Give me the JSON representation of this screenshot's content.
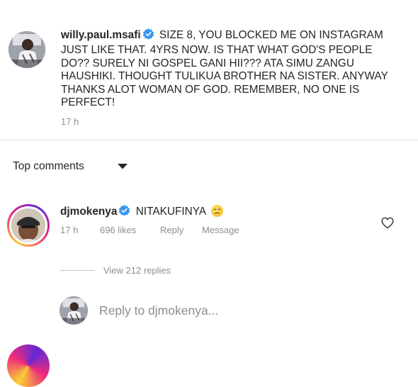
{
  "post": {
    "username": "willy.paul.msafi",
    "verified": true,
    "text": "SIZE 8, YOU BLOCKED ME ON INSTAGRAM JUST LIKE THAT. 4YRS NOW. IS THAT WHAT GOD'S PEOPLE DO?? SURELY NI GOSPEL GANI HII??? ATA SIMU ZANGU HAUSHIKI. THOUGHT TULIKUA BROTHER NA SISTER. ANYWAY THANKS ALOT WOMAN OF GOD. REMEMBER,  NO ONE IS PERFECT!",
    "time": "17 h"
  },
  "comments_header": {
    "label": "Top comments"
  },
  "comment": {
    "username": "djmokenya",
    "verified": true,
    "text": "NITAKUFINYA",
    "time": "17 h",
    "likes": "696 likes",
    "reply_label": "Reply",
    "message_label": "Message",
    "view_replies": "View 212 replies"
  },
  "reply_box": {
    "placeholder": "Reply to djmokenya..."
  },
  "colors": {
    "text": "#262626",
    "secondary": "#8e8e8e",
    "verified": "#3897f0",
    "divider": "#dbdbdb"
  },
  "icons": [
    "verified-badge-icon",
    "chevron-down-icon",
    "heart-icon",
    "emoji-unamused-icon"
  ]
}
